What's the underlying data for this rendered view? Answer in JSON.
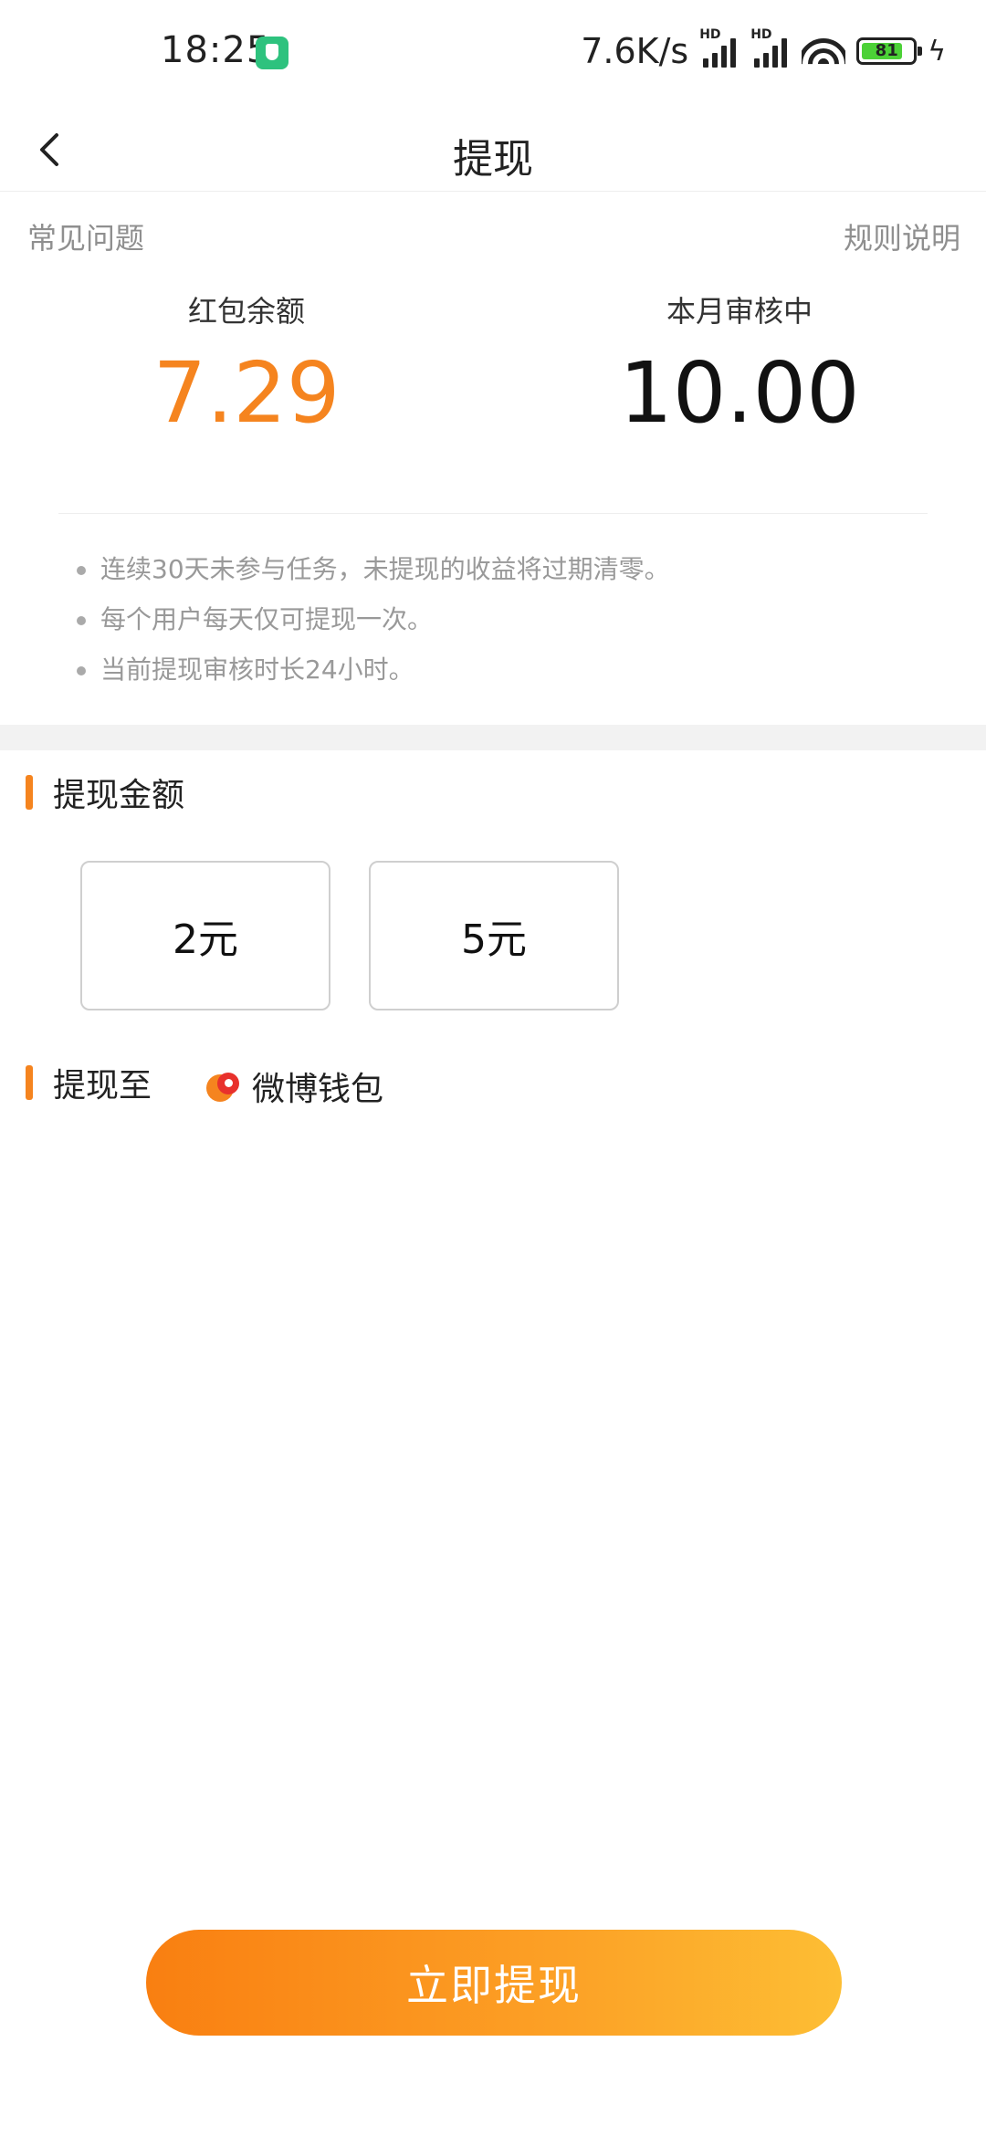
{
  "status_bar": {
    "time": "18:25",
    "net_speed": "7.6K/s",
    "hd_label": "HD",
    "battery": "81",
    "battery_level": 0.81,
    "app_icon": "shield-icon"
  },
  "nav": {
    "title": "提现",
    "back_icon": "chevron-left-icon"
  },
  "links": {
    "faq": "常见问题",
    "rules": "规则说明"
  },
  "balances": {
    "red_packet_label": "红包余额",
    "red_packet_value": "7.29",
    "reviewing_label": "本月审核中",
    "reviewing_value": "10.00"
  },
  "tips": [
    "连续30天未参与任务，未提现的收益将过期清零。",
    "每个用户每天仅可提现一次。",
    "当前提现审核时长24小时。"
  ],
  "amount_section": {
    "title": "提现金额",
    "options": [
      "2元",
      "5元"
    ]
  },
  "withdraw_to": {
    "title": "提现至",
    "wallet_name": "微博钱包",
    "wallet_icon": "weibo-wallet-icon"
  },
  "submit_label": "立即提现",
  "colors": {
    "accent": "#f5841f",
    "button_start": "#f97f11",
    "button_end": "#fdbe34"
  }
}
